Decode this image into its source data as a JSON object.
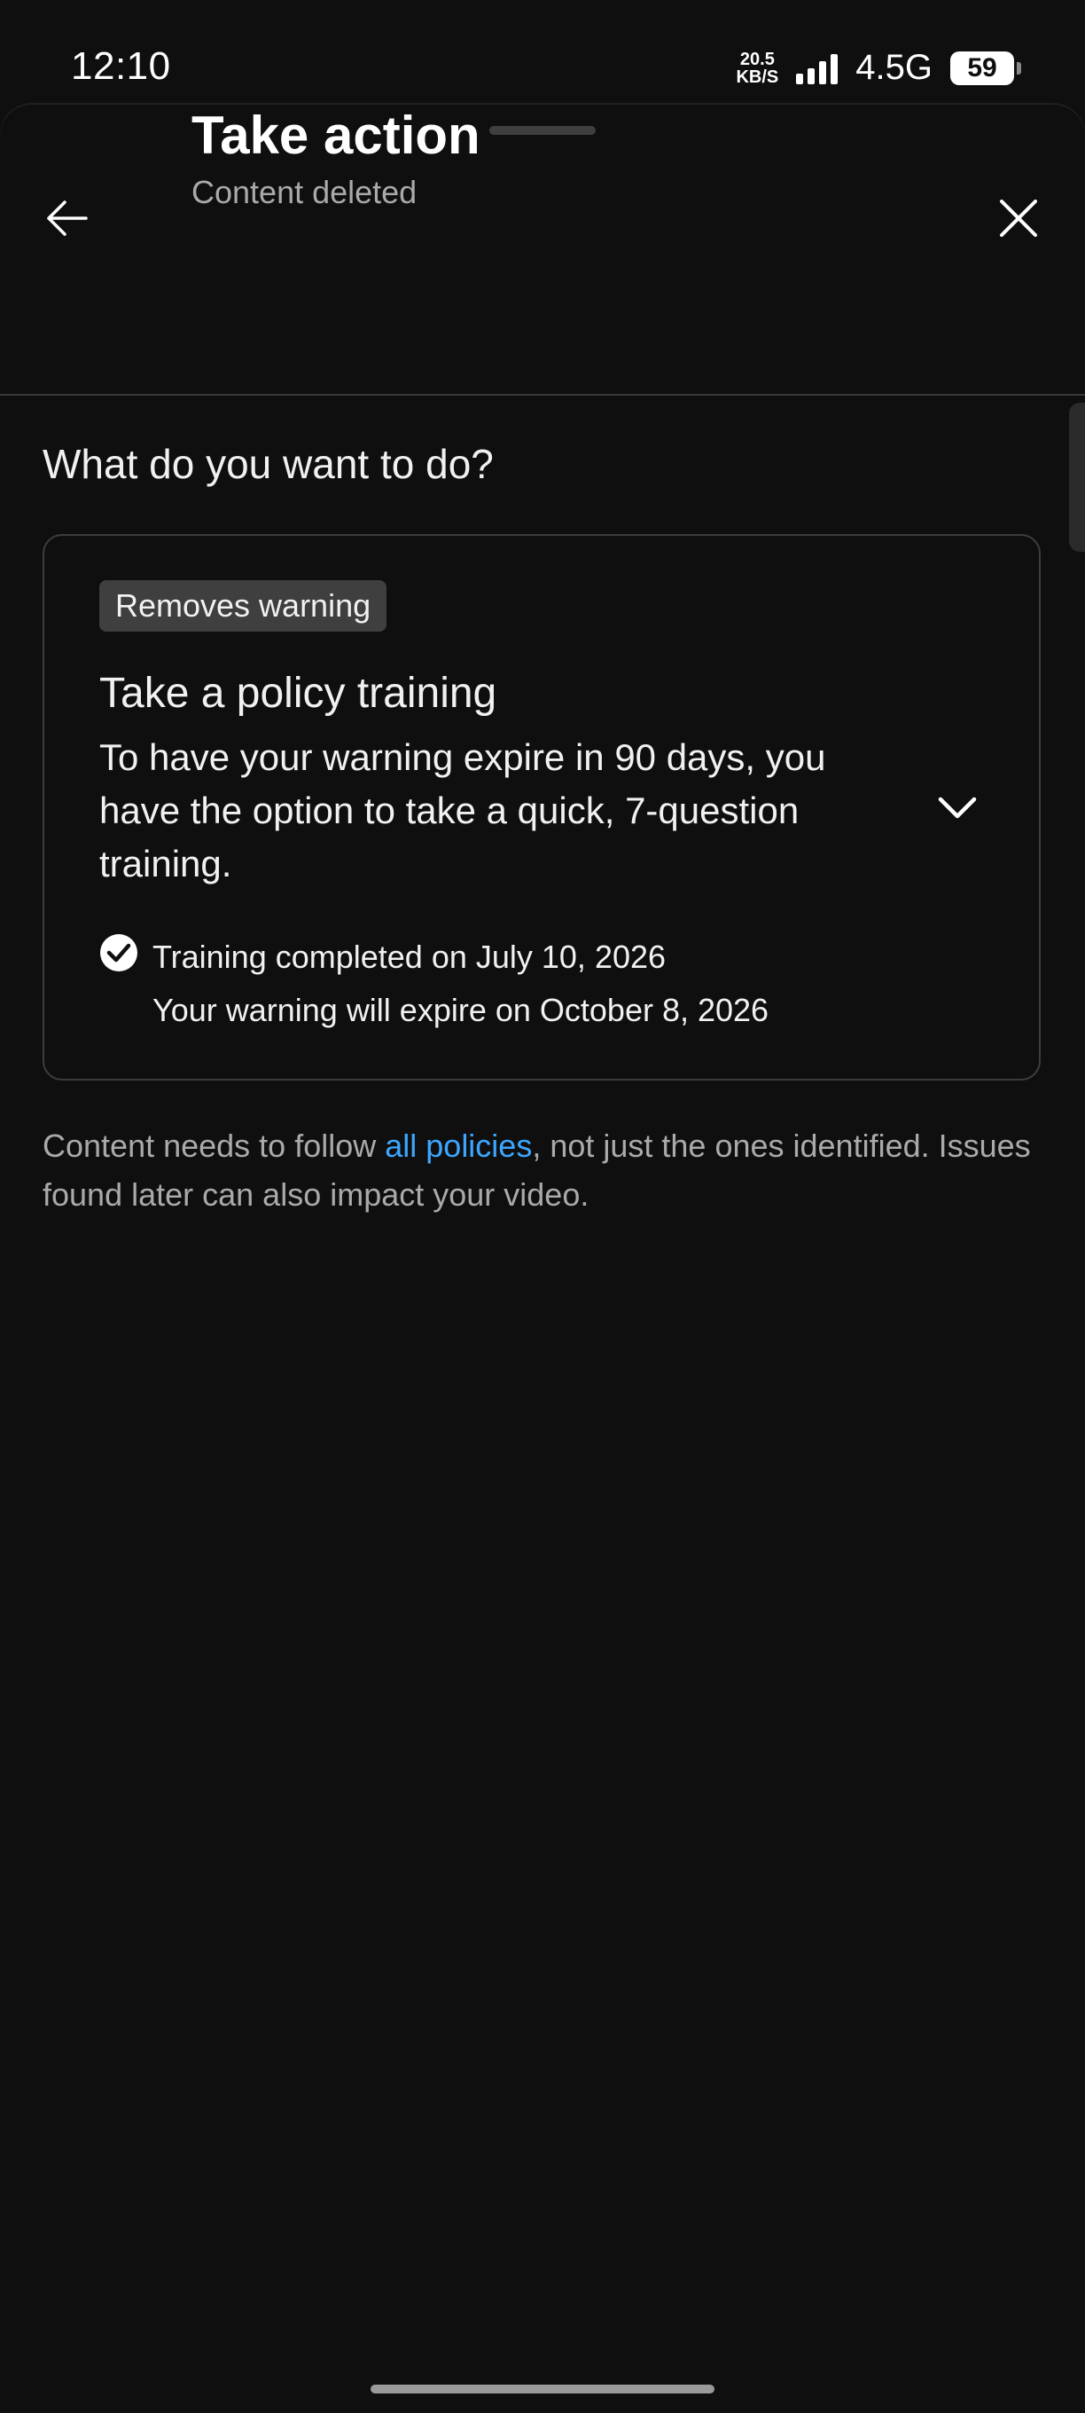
{
  "status_bar": {
    "time": "12:10",
    "net_speed_value": "20.5",
    "net_speed_unit": "KB/S",
    "network_type": "4.5G",
    "battery": "59"
  },
  "header": {
    "title": "Take action",
    "subtitle": "Content deleted",
    "back_icon": "arrow-left-icon",
    "close_icon": "close-icon"
  },
  "main": {
    "question": "What do you want to do?",
    "card": {
      "badge": "Removes warning",
      "title": "Take a policy training",
      "body": "To have your warning expire in 90 days, you have the option to take a quick, 7-question training.",
      "expand_icon": "chevron-down-icon",
      "status_icon": "check-circle-icon",
      "status_line1": "Training completed on July 10, 2026",
      "status_line2": "Your warning will expire on October 8, 2026"
    },
    "footer": {
      "text_before": "Content needs to follow ",
      "link_text": "all policies",
      "text_after": ", not just the ones identified. Issues found later can also impact your video."
    }
  },
  "colors": {
    "background": "#0f0f0f",
    "link": "#3ea6ff",
    "secondary_text": "#aaaaaa",
    "badge_bg": "#3f3f3f"
  }
}
